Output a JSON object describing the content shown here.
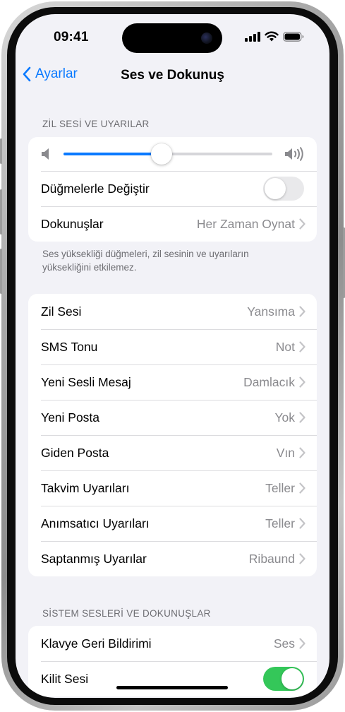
{
  "status_bar": {
    "time": "09:41"
  },
  "nav": {
    "back_label": "Ayarlar",
    "title": "Ses ve Dokunuş"
  },
  "ringer_section": {
    "header": "ZİL SESİ VE UYARILAR",
    "volume_level": 0.47,
    "change_with_buttons": {
      "label": "Düğmelerle Değiştir",
      "on": false
    },
    "haptics": {
      "label": "Dokunuşlar",
      "value": "Her Zaman Oynat"
    },
    "footnote": "Ses yüksekliği düğmeleri, zil sesinin ve uyarıların yüksekliğini etkilemez."
  },
  "sounds": [
    {
      "label": "Zil Sesi",
      "value": "Yansıma"
    },
    {
      "label": "SMS Tonu",
      "value": "Not"
    },
    {
      "label": "Yeni Sesli Mesaj",
      "value": "Damlacık"
    },
    {
      "label": "Yeni Posta",
      "value": "Yok"
    },
    {
      "label": "Giden Posta",
      "value": "Vın"
    },
    {
      "label": "Takvim Uyarıları",
      "value": "Teller"
    },
    {
      "label": "Anımsatıcı Uyarıları",
      "value": "Teller"
    },
    {
      "label": "Saptanmış Uyarılar",
      "value": "Ribaund"
    }
  ],
  "system_section": {
    "header": "SİSTEM SESLERİ VE DOKUNUŞLAR",
    "keyboard_feedback": {
      "label": "Klavye Geri Bildirimi",
      "value": "Ses"
    },
    "lock_sound": {
      "label": "Kilit Sesi",
      "on": true
    }
  },
  "colors": {
    "accent": "#0a7aff",
    "toggle_on": "#34c759",
    "toggle_off": "#e9e9eb",
    "background": "#f2f2f7"
  },
  "icons": {
    "back": "chevron-left-icon",
    "disclosure": "chevron-right-icon",
    "volume_low": "speaker-icon",
    "volume_high": "speaker-wave-icon",
    "signal": "cellular-signal-icon",
    "wifi": "wifi-icon",
    "battery": "battery-icon"
  }
}
